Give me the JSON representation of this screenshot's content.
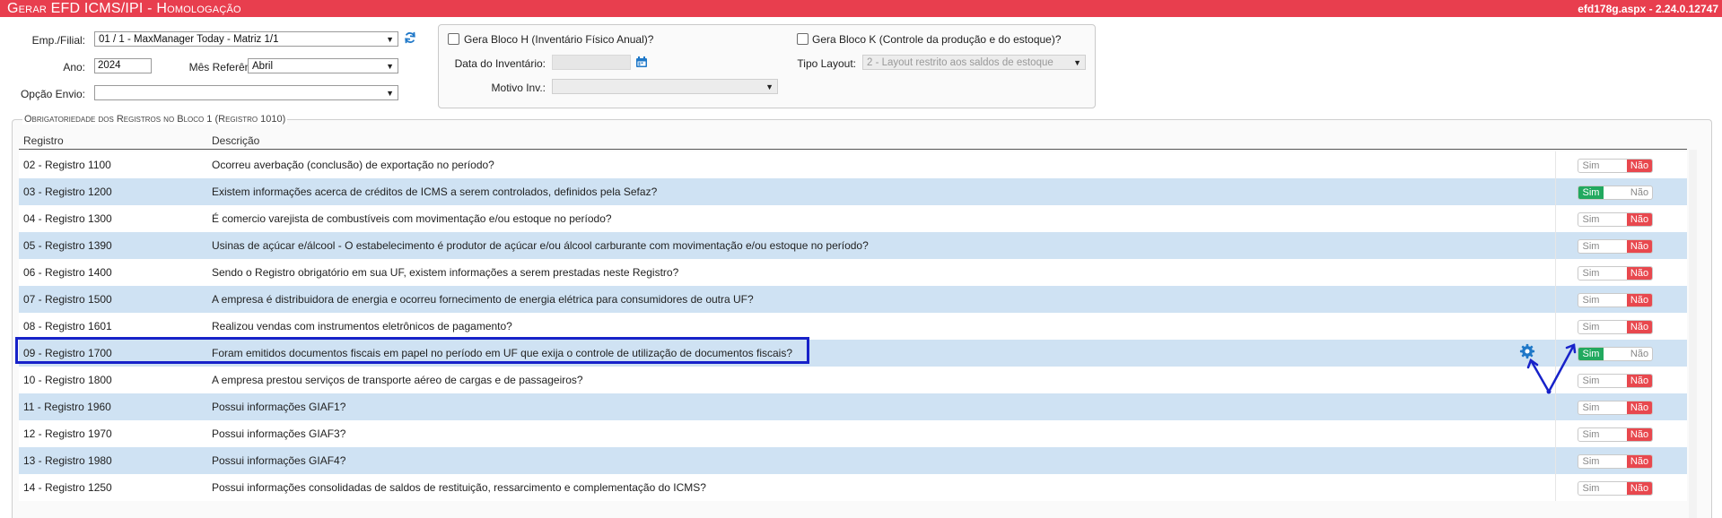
{
  "header": {
    "title": "Gerar EFD ICMS/IPI  - Homologação",
    "version": "efd178g.aspx - 2.24.0.12747"
  },
  "form": {
    "emp_label": "Emp./Filial:",
    "emp_value": "01 / 1 - MaxManager Today - Matriz 1/1",
    "ano_label": "Ano:",
    "ano_value": "2024",
    "mes_label": "Mês Referência:",
    "mes_value": "Abril",
    "opcao_label": "Opção Envio:",
    "opcao_value": ""
  },
  "bloco_h": {
    "checkbox_label": "Gera Bloco H (Inventário Físico Anual)?",
    "data_label": "Data do Inventário:",
    "data_value": "",
    "motivo_label": "Motivo Inv.:",
    "motivo_value": ""
  },
  "bloco_k": {
    "checkbox_label": "Gera Bloco K (Controle da produção e do estoque)?",
    "tipo_label": "Tipo Layout:",
    "tipo_value": "2 - Layout restrito aos saldos de estoque"
  },
  "section": {
    "legend": "Obrigatoriedade dos Registros no Bloco 1 (Registro 1010)"
  },
  "table": {
    "columns": [
      "Registro",
      "Descrição"
    ],
    "toggle_yes": "Sim",
    "toggle_no": "Não",
    "rows": [
      {
        "registro": "02 - Registro 1100",
        "descricao": "Ocorreu averbação (conclusão) de exportação no período?",
        "value": "Não"
      },
      {
        "registro": "03 - Registro 1200",
        "descricao": "Existem informações acerca de créditos de ICMS a serem controlados, definidos pela Sefaz?",
        "value": "Sim"
      },
      {
        "registro": "04 - Registro 1300",
        "descricao": "É comercio varejista de combustíveis com movimentação e/ou estoque no período?",
        "value": "Não"
      },
      {
        "registro": "05 - Registro 1390",
        "descricao": "Usinas de açúcar e/álcool - O estabelecimento é produtor de açúcar e/ou álcool carburante com movimentação e/ou estoque no período?",
        "value": "Não"
      },
      {
        "registro": "06 - Registro 1400",
        "descricao": "Sendo o Registro obrigatório em sua UF, existem informações a serem prestadas neste Registro?",
        "value": "Não"
      },
      {
        "registro": "07 - Registro 1500",
        "descricao": "A empresa é distribuidora de energia e ocorreu fornecimento de energia elétrica para consumidores de outra UF?",
        "value": "Não"
      },
      {
        "registro": "08 - Registro 1601",
        "descricao": "Realizou vendas com instrumentos eletrônicos de pagamento?",
        "value": "Não"
      },
      {
        "registro": "09 - Registro 1700",
        "descricao": "Foram emitidos documentos fiscais em papel no período em UF que exija o controle de utilização de documentos fiscais?",
        "value": "Sim"
      },
      {
        "registro": "10 - Registro 1800",
        "descricao": "A empresa prestou serviços de transporte aéreo de cargas e de passageiros?",
        "value": "Não"
      },
      {
        "registro": "11 - Registro 1960",
        "descricao": "Possui informações GIAF1?",
        "value": "Não"
      },
      {
        "registro": "12 - Registro 1970",
        "descricao": "Possui informações GIAF3?",
        "value": "Não"
      },
      {
        "registro": "13 - Registro 1980",
        "descricao": "Possui informações GIAF4?",
        "value": "Não"
      },
      {
        "registro": "14 - Registro 1250",
        "descricao": "Possui informações consolidadas de saldos de restituição, ressarcimento e complementação do ICMS?",
        "value": "Não"
      }
    ]
  },
  "colors": {
    "header_bg": "#e83e4e",
    "row_alt": "#cfe2f3",
    "toggle_yes": "#22a95f",
    "toggle_no": "#e8484e",
    "highlight": "#1722c9",
    "accent_icon": "#1f78c8"
  },
  "icons": [
    "refresh-icon",
    "calendar-icon",
    "gear-icon",
    "dropdown-arrow-icon"
  ]
}
